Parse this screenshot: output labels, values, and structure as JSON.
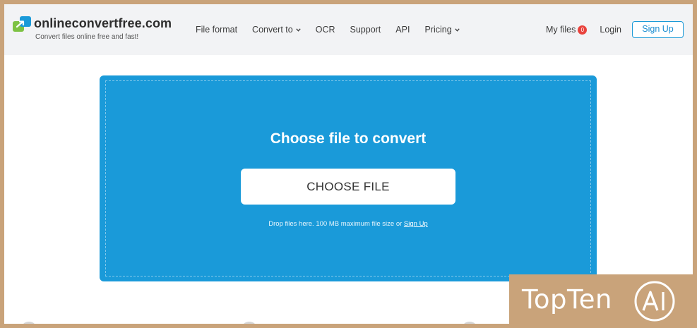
{
  "brand": {
    "name": "onlineconvertfree.com",
    "tagline": "Convert files online free and fast!"
  },
  "nav": {
    "items": [
      {
        "label": "File format",
        "dropdown": false
      },
      {
        "label": "Convert to",
        "dropdown": true
      },
      {
        "label": "OCR",
        "dropdown": false
      },
      {
        "label": "Support",
        "dropdown": false
      },
      {
        "label": "API",
        "dropdown": false
      },
      {
        "label": "Pricing",
        "dropdown": true
      }
    ],
    "my_files_label": "My files",
    "my_files_count": "0",
    "login_label": "Login",
    "signup_label": "Sign Up"
  },
  "upload": {
    "title": "Choose file to convert",
    "button_label": "CHOOSE FILE",
    "hint_text": "Drop files here. 100 MB maximum file size or",
    "hint_link": "Sign Up"
  },
  "watermark": {
    "text": "TopTen",
    "circle_text": "AI"
  },
  "colors": {
    "accent": "#1a9ad9",
    "badge": "#e9433d",
    "frame": "#c9a37a",
    "header_bg": "#f2f3f5"
  }
}
